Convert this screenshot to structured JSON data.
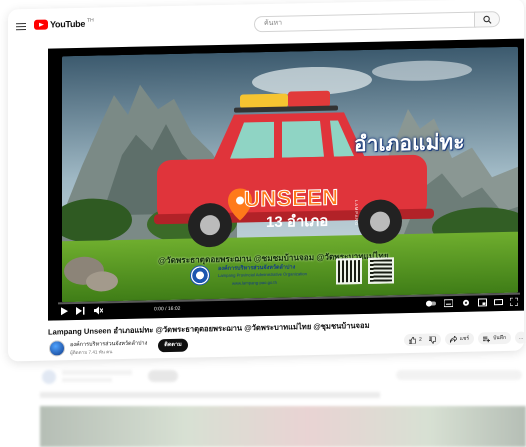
{
  "header": {
    "logo_text": "YouTube",
    "logo_superscript": "TH",
    "search_placeholder": "ค้นหา"
  },
  "video": {
    "thumbnail_title": "อำเภอแม่ทะ",
    "badge_main": "UNSEEN",
    "badge_sub": "13 อำเภอ",
    "badge_vertical": "LAMPANG",
    "caption_places": "@วัดพระธาตุดอยพระฌาน @ชมชมบ้านจอม @วัดพระบาทแม่ไทย",
    "org_line1": "องค์การบริหารส่วนจังหวัดลำปาง",
    "org_line2": "Lampang Provincial Administrative Organization",
    "org_url": "www.lampang-pao.go.th",
    "time_label": "0:00 / 16:02",
    "progress": 0.0
  },
  "info": {
    "title": "Lampang Unseen อำเภอแม่ทะ @วัดพระธาตุดอยพระฌาน @วัดพระบาทแม่ไทย @ชุมชนบ้านจอม",
    "channel_name": "องค์การบริหารส่วนจังหวัดลำปาง",
    "channel_subs": "ผู้ติดตาม 7.41 พัน คน",
    "subscribe_label": "ติดตาม",
    "like_count": "2",
    "share_label": "แชร์",
    "save_label": "บันทึก",
    "more_label": "..."
  },
  "colors": {
    "brand_red": "#ff0000",
    "car_red": "#e0343b",
    "badge_orange": "#ff7a1a"
  }
}
